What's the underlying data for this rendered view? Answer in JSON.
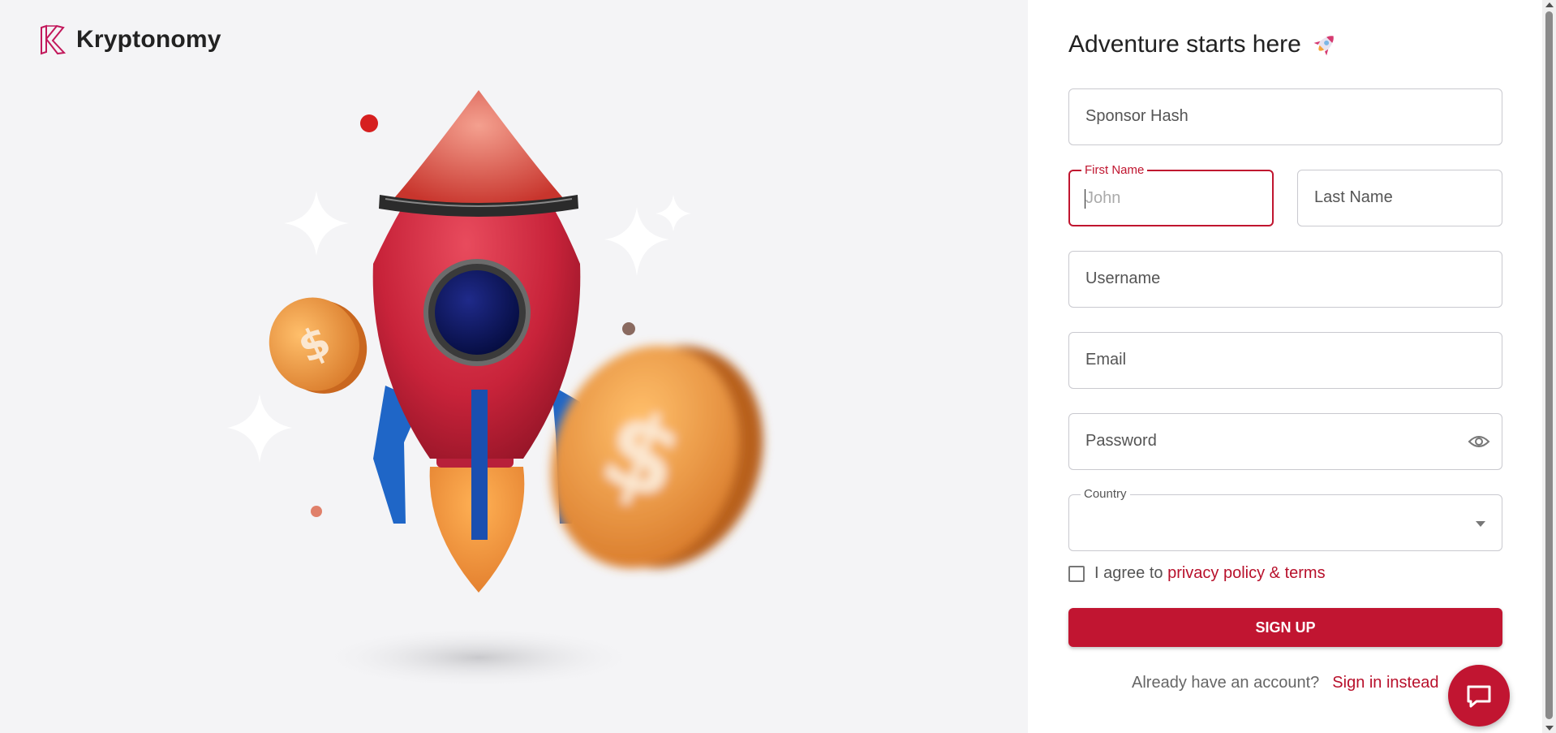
{
  "brand": {
    "name": "Kryptonomy",
    "logo_icon": "kryptonomy-logo-icon"
  },
  "form": {
    "title": "Adventure starts here",
    "title_icon": "rocket-emoji-icon",
    "sponsor_hash_placeholder": "Sponsor Hash",
    "first_name_label": "First Name",
    "first_name_placeholder": "John",
    "last_name_placeholder": "Last Name",
    "username_placeholder": "Username",
    "email_placeholder": "Email",
    "password_placeholder": "Password",
    "password_toggle_icon": "eye-icon",
    "country_label": "Country",
    "country_value": "",
    "agree_prefix": "I agree to",
    "agree_link": "privacy policy & terms",
    "agree_checked": false,
    "signup_label": "SIGN UP",
    "already_text": "Already have an account?",
    "signin_link": "Sign in instead"
  },
  "chat": {
    "icon": "chat-bubble-icon"
  },
  "colors": {
    "accent": "#c11531",
    "link": "#b8102b",
    "left_bg": "#f4f4f6"
  }
}
